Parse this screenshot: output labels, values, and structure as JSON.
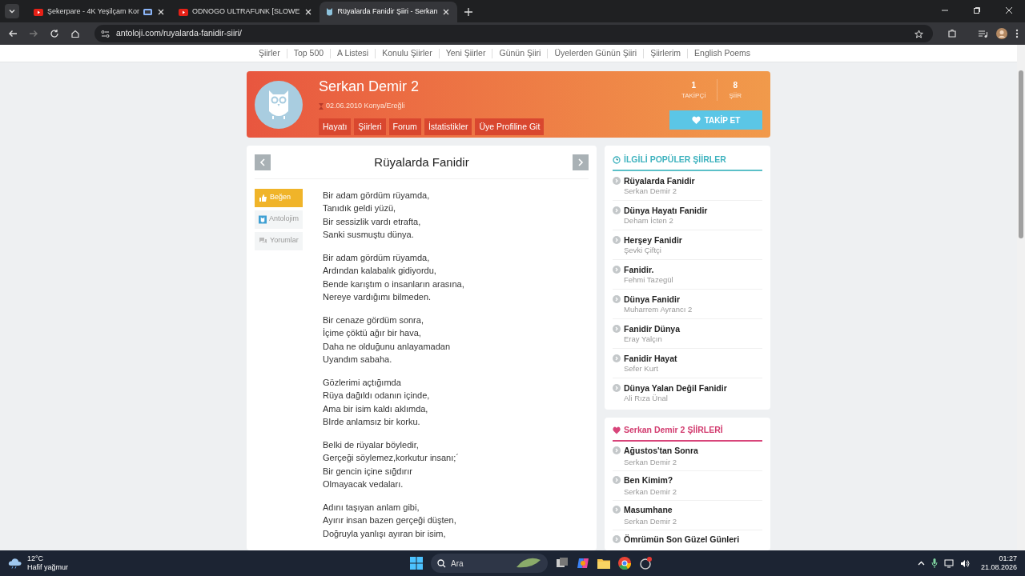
{
  "browser": {
    "tabs": [
      {
        "title": "Şekerpare - 4K Yeşilçam Kor",
        "kind": "video",
        "selected": false,
        "media": true
      },
      {
        "title": "ODNOGO ULTRAFUNK [SLOWE",
        "kind": "video",
        "selected": false,
        "media": false
      },
      {
        "title": "Rüyalarda Fanidir Şiiri - Serkan",
        "kind": "site",
        "selected": true,
        "media": false
      }
    ],
    "url": "antoloji.com/ruyalarda-fanidir-siiri/"
  },
  "nav": [
    "Şiirler",
    "Top 500",
    "A Listesi",
    "Konulu Şiirler",
    "Yeni Şiirler",
    "Günün Şiiri",
    "Üyelerden Günün Şiiri",
    "Şiirlerim",
    "English Poems"
  ],
  "profile": {
    "name": "Serkan Demir 2",
    "meta": "02.06.2010 Konya/Ereğli",
    "links": [
      "Hayatı",
      "Şiirleri",
      "Forum",
      "İstatistikler",
      "Üye Profiline Git"
    ],
    "stats": [
      {
        "value": "1",
        "label": "TAKİPÇİ"
      },
      {
        "value": "8",
        "label": "ŞİİR"
      }
    ],
    "follow": "TAKİP ET"
  },
  "poem": {
    "title": "Rüyalarda Fanidir",
    "actions": [
      {
        "label": "Beğen",
        "kind": "like"
      },
      {
        "label": "Antolojim",
        "kind": "anthology"
      },
      {
        "label": "Yorumlar",
        "kind": "comments"
      }
    ],
    "stanzas": [
      [
        "Bir adam gördüm rüyamda,",
        "Tanıdık geldi yüzü,",
        "Bir sessizlik vardı etrafta,",
        "Sanki susmuştu dünya."
      ],
      [
        "Bir adam gördüm rüyamda,",
        "Ardından kalabalık gidiyordu,",
        "Bende karıştım o insanların arasına,",
        "Nereye vardığımı bilmeden."
      ],
      [
        "Bir cenaze gördüm sonra,",
        "İçime çöktü ağır bir hava,",
        "Daha ne olduğunu anlayamadan",
        "Uyandım sabaha."
      ],
      [
        "Gözlerimi açtığımda",
        "Rüya dağıldı odanın içinde,",
        "Ama bir isim kaldı aklımda,",
        "BIrde anlamsız bir korku."
      ],
      [
        "Belki de rüyalar böyledir,",
        "Gerçeği söylemez,korkutur insanı;´",
        "Bir gencin içine sığdırır",
        "Olmayacak vedaları."
      ],
      [
        "Adını taşıyan anlam gibi,",
        "Ayırır insan bazen gerçeği düşten,",
        "Doğruyla yanlışı ayıran bir isim,"
      ]
    ]
  },
  "related": {
    "title": "İLGİLİ POPÜLER ŞİİRLER",
    "items": [
      {
        "title": "Rüyalarda Fanidir",
        "author": "Serkan Demir 2"
      },
      {
        "title": "Dünya Hayatı Fanidir",
        "author": "Deham İcten 2"
      },
      {
        "title": "Herşey Fanidir",
        "author": "Şevki Çiftçi"
      },
      {
        "title": "Fanidir.",
        "author": "Fehmi Tazegül"
      },
      {
        "title": "Dünya Fanidir",
        "author": "Muharrem Ayrancı 2"
      },
      {
        "title": "Fanidir Dünya",
        "author": "Eray Yalçın"
      },
      {
        "title": "Fanidir Hayat",
        "author": "Sefer Kurt"
      },
      {
        "title": "Dünya Yalan Değil Fanidir",
        "author": "Ali Rıza Ünal"
      }
    ]
  },
  "author_poems": {
    "title": "Serkan Demir 2 ŞİİRLERİ",
    "items": [
      {
        "title": "Ağustos'tan Sonra",
        "author": "Serkan Demir 2"
      },
      {
        "title": "Ben Kimim?",
        "author": "Serkan Demir 2"
      },
      {
        "title": "Masumhane",
        "author": "Serkan Demir 2"
      },
      {
        "title": "Ömrümün Son Güzel Günleri"
      }
    ]
  },
  "taskbar": {
    "temp": "12°C",
    "weather": "Hafif yağmur",
    "search": "Ara",
    "time": "01:27",
    "date": "21.08.2026"
  }
}
